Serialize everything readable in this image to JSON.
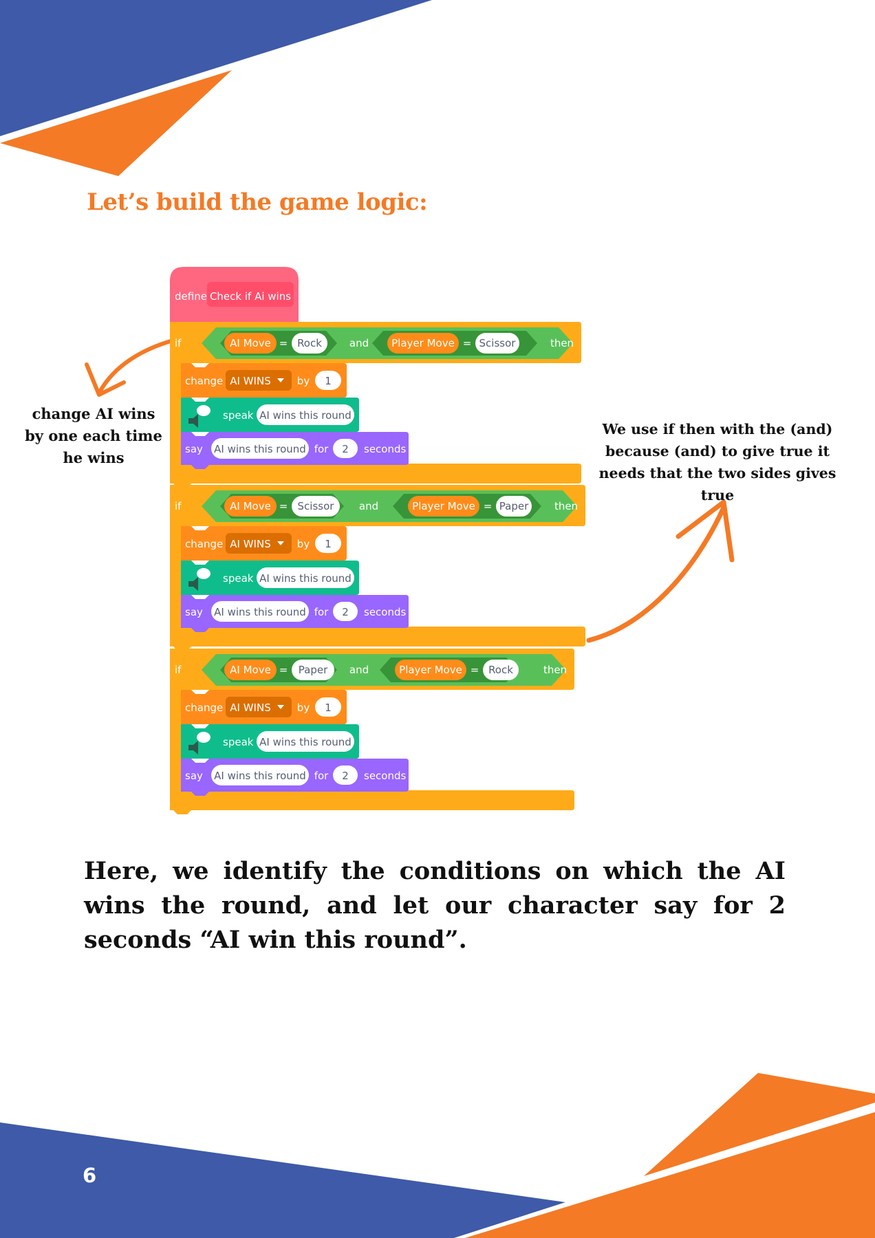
{
  "colors": {
    "blue": "#3e5aa8",
    "orange": "#f47a25",
    "control_block": "#ffab19",
    "control_dark": "#cf8b17",
    "operator_block": "#59c059",
    "operator_dark": "#389438",
    "variable_block": "#ff8c1a",
    "variable_dark": "#db6e00",
    "looks_block": "#9966ff",
    "tts_block": "#0fbd8c",
    "define_block": "#ff6680",
    "define_dark": "#ff4d6a",
    "heading_text": "#f47a25"
  },
  "heading": "Let’s build the game logic:",
  "annotations": {
    "left": "change AI wins by one each time he wins",
    "right": "We use if then with the (and) because (and) to give true it needs that the two sides gives true"
  },
  "code": {
    "define_keyword": "define",
    "define_name": "Check if Ai wins",
    "blocks": [
      {
        "if_label": "if",
        "left_var": "AI Move",
        "eq1": "=",
        "left_val": "Rock",
        "and_label": "and",
        "right_var": "Player Move",
        "eq2": "=",
        "right_val": "Scissor",
        "then_label": "then",
        "change_label": "change",
        "change_var": "AI WINS",
        "change_by": "by",
        "change_amount": "1",
        "speak_label": "speak",
        "speak_text": "AI wins this round",
        "say_label": "say",
        "say_text": "AI wins this round",
        "say_for": "for",
        "say_secs": "2",
        "say_unit": "seconds"
      },
      {
        "if_label": "if",
        "left_var": "AI Move",
        "eq1": "=",
        "left_val": "Scissor",
        "and_label": "and",
        "right_var": "Player Move",
        "eq2": "=",
        "right_val": "Paper",
        "then_label": "then",
        "change_label": "change",
        "change_var": "AI WINS",
        "change_by": "by",
        "change_amount": "1",
        "speak_label": "speak",
        "speak_text": "AI wins this round",
        "say_label": "say",
        "say_text": "AI wins this round",
        "say_for": "for",
        "say_secs": "2",
        "say_unit": "seconds"
      },
      {
        "if_label": "if",
        "left_var": "AI Move",
        "eq1": "=",
        "left_val": "Paper",
        "and_label": "and",
        "right_var": "Player Move",
        "eq2": "=",
        "right_val": "Rock",
        "then_label": "then",
        "change_label": "change",
        "change_var": "AI WINS",
        "change_by": "by",
        "change_amount": "1",
        "speak_label": "speak",
        "speak_text": "AI wins this round",
        "say_label": "say",
        "say_text": "AI wins this round",
        "say_for": "for",
        "say_secs": "2",
        "say_unit": "seconds"
      }
    ]
  },
  "body_text": "Here, we identify the conditions on which the AI wins the round, and let our character say for 2 seconds “AI win this round”.",
  "page_number": "6"
}
